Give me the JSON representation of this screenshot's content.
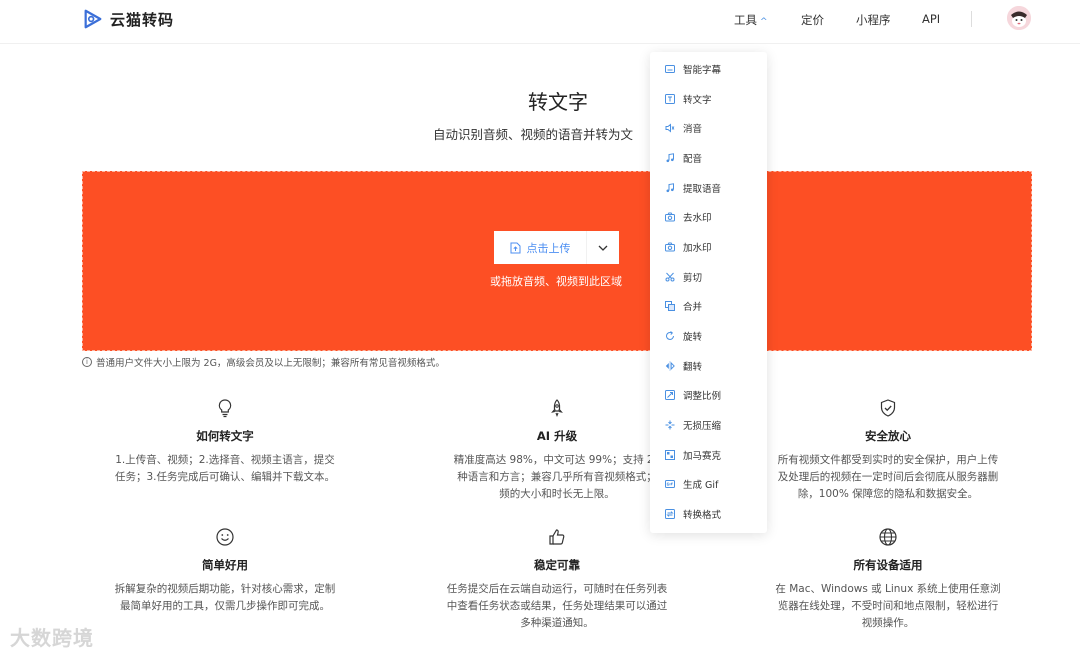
{
  "header": {
    "logo_text": "云猫转码",
    "nav": {
      "tools": "工具",
      "pricing": "定价",
      "mini_program": "小程序",
      "api": "API"
    },
    "accent": "#4a90e2"
  },
  "hero": {
    "title": "转文字",
    "subtitle": "自动识别音频、视频的语音并转为文",
    "upload_label": "点击上传",
    "drop_hint": "或拖放音频、视频到此区域",
    "notice": "普通用户文件大小上限为 2G，高级会员及以上无限制；兼容所有常见音视频格式。",
    "upload_color": "#fd4f24"
  },
  "features": [
    {
      "title": "如何转文字",
      "desc": [
        "1.上传音、视频；2.选择音、视频主语言，提交",
        "任务；3.任务完成后可确认、编辑并下载文本。"
      ],
      "icon": "lightbulb-icon"
    },
    {
      "title": "AI 升级",
      "desc": [
        "精准度高达 98%，中文可达 99%；支持 20",
        "种语言和方言；兼容几乎所有音视频格式；",
        "频的大小和时长无上限。"
      ],
      "icon": "rocket-icon"
    },
    {
      "title": "安全放心",
      "desc": [
        "所有视频文件都受到实时的安全保护，用户上传",
        "及处理后的视频在一定时间后会彻底从服务器删",
        "除，100% 保障您的隐私和数据安全。"
      ],
      "icon": "shield-check-icon"
    },
    {
      "title": "简单好用",
      "desc": [
        "拆解复杂的视频后期功能，针对核心需求，定制",
        "最简单好用的工具，仅需几步操作即可完成。"
      ],
      "icon": "smile-icon"
    },
    {
      "title": "稳定可靠",
      "desc": [
        "任务提交后在云端自动运行，可随时在任务列表",
        "中查看任务状态或结果，任务处理结果可以通过",
        "多种渠道通知。"
      ],
      "icon": "thumbs-up-icon"
    },
    {
      "title": "所有设备适用",
      "desc": [
        "在 Mac、Windows 或 Linux 系统上使用任意浏",
        "览器在线处理，不受时间和地点限制，轻松进行",
        "视频操作。"
      ],
      "icon": "globe-icon"
    }
  ],
  "tools_menu": [
    {
      "label": "智能字幕",
      "icon": "subtitle-icon"
    },
    {
      "label": "转文字",
      "icon": "text-icon"
    },
    {
      "label": "消音",
      "icon": "mute-icon"
    },
    {
      "label": "配音",
      "icon": "music-note-icon"
    },
    {
      "label": "提取语音",
      "icon": "music-note-icon"
    },
    {
      "label": "去水印",
      "icon": "camera-icon"
    },
    {
      "label": "加水印",
      "icon": "camera-icon"
    },
    {
      "label": "剪切",
      "icon": "scissors-icon"
    },
    {
      "label": "合并",
      "icon": "merge-icon"
    },
    {
      "label": "旋转",
      "icon": "rotate-icon"
    },
    {
      "label": "翻转",
      "icon": "flip-icon"
    },
    {
      "label": "调整比例",
      "icon": "resize-icon"
    },
    {
      "label": "无损压缩",
      "icon": "compress-icon"
    },
    {
      "label": "加马赛克",
      "icon": "mosaic-icon"
    },
    {
      "label": "生成 Gif",
      "icon": "gif-icon"
    },
    {
      "label": "转换格式",
      "icon": "convert-icon"
    }
  ],
  "watermark": "大数跨境"
}
